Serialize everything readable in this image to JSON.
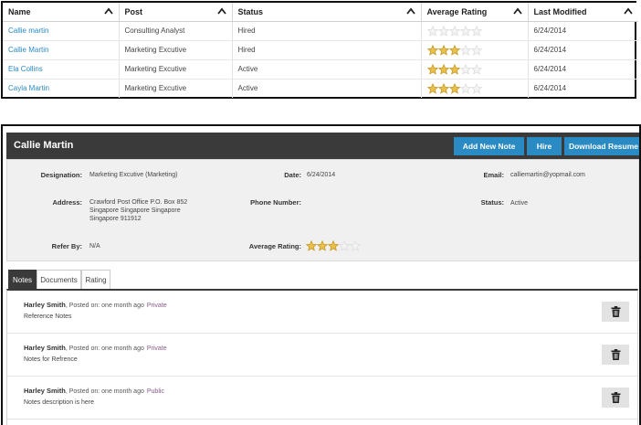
{
  "grid": {
    "columns": [
      "Name",
      "Post",
      "Status",
      "Average Rating",
      "Last Modified"
    ],
    "rows": [
      {
        "name": "Callie martin",
        "post": "Consulting Analyst",
        "status": "Hired",
        "rating": 0,
        "modified": "6/24/2014"
      },
      {
        "name": "Callie Martin",
        "post": "Marketing Excutive",
        "status": "Hired",
        "rating": 3,
        "modified": "6/24/2014"
      },
      {
        "name": "Ela Collins",
        "post": "Marketing Excutive",
        "status": "Active",
        "rating": 3,
        "modified": "6/24/2014"
      },
      {
        "name": "Cayla Martin",
        "post": "Marketing Excutive",
        "status": "Active",
        "rating": 3,
        "modified": "6/24/2014"
      }
    ],
    "max_rating": 5
  },
  "detail": {
    "title": "Callie Martin",
    "buttons": {
      "add_note": "Add New Note",
      "hire": "Hire",
      "download": "Download Resume"
    },
    "designation_label": "Designation:",
    "designation": "Marketing Excutive (Marketing)",
    "date_label": "Date:",
    "date": "6/24/2014",
    "email_label": "Email:",
    "email": "calliemartin@yopmail.com",
    "address_label": "Address:",
    "address_lines": [
      "Crawford Post Office P.O. Box 852",
      "Singapore Singapore Singapore",
      "Singapore 911912"
    ],
    "phone_label": "Phone Number:",
    "phone": "",
    "status_label": "Status:",
    "status": "Active",
    "referby_label": "Refer By:",
    "referby": "N/A",
    "avg_rating_label": "Average Rating:",
    "avg_rating": 3
  },
  "tabs": [
    "Notes",
    "Documents",
    "Rating"
  ],
  "active_tab": "Notes",
  "notes": [
    {
      "author": "Harley Smith",
      "posted": ", Posted on: one month ago",
      "privacy": "Private",
      "text": "Reference Notes"
    },
    {
      "author": "Harley Smith",
      "posted": ", Posted on: one month ago",
      "privacy": "Private",
      "text": "Notes for Refrence"
    },
    {
      "author": "Harley Smith",
      "posted": ", Posted on: one month ago",
      "privacy": "Public",
      "text": "Notes description is here"
    }
  ],
  "colors": {
    "accent": "#2a8ac3",
    "header_dark": "#3a3a3a",
    "star_filled": "#e8c04a",
    "star_empty": "#dcdcdc"
  },
  "icons": [
    "sort-caret-icon",
    "star-icon",
    "trash-icon"
  ]
}
